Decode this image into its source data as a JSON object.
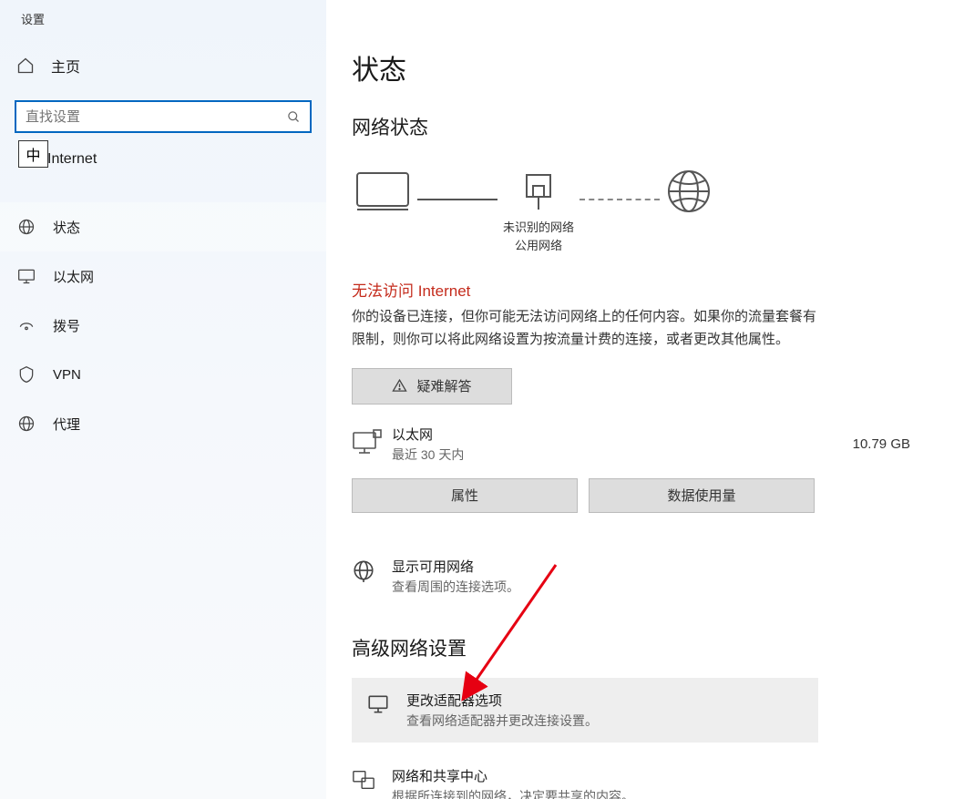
{
  "app_title": "设置",
  "sidebar": {
    "home": "主页",
    "search_placeholder": "直找设置",
    "ime_badge": "中",
    "category": "Internet",
    "items": [
      {
        "label": "状态"
      },
      {
        "label": "以太网"
      },
      {
        "label": "拨号"
      },
      {
        "label": "VPN"
      },
      {
        "label": "代理"
      }
    ]
  },
  "main": {
    "title": "状态",
    "net_status_heading": "网络状态",
    "diagram": {
      "mid_label1": "未识别的网络",
      "mid_label2": "公用网络"
    },
    "error_title": "无法访问 Internet",
    "error_desc": "你的设备已连接，但你可能无法访问网络上的任何内容。如果你的流量套餐有限制，则你可以将此网络设置为按流量计费的连接，或者更改其他属性。",
    "troubleshoot_btn": "疑难解答",
    "ethernet": {
      "name": "以太网",
      "recent": "最近 30 天内",
      "usage": "10.79 GB",
      "properties_btn": "属性",
      "usage_btn": "数据使用量"
    },
    "show_networks": {
      "title": "显示可用网络",
      "desc": "查看周围的连接选项。"
    },
    "advanced_heading": "高级网络设置",
    "adapter_opts": {
      "title": "更改适配器选项",
      "desc": "查看网络适配器并更改连接设置。"
    },
    "sharing": {
      "title": "网络和共享中心",
      "desc": "根据所连接到的网络，决定要共享的内容。"
    }
  }
}
